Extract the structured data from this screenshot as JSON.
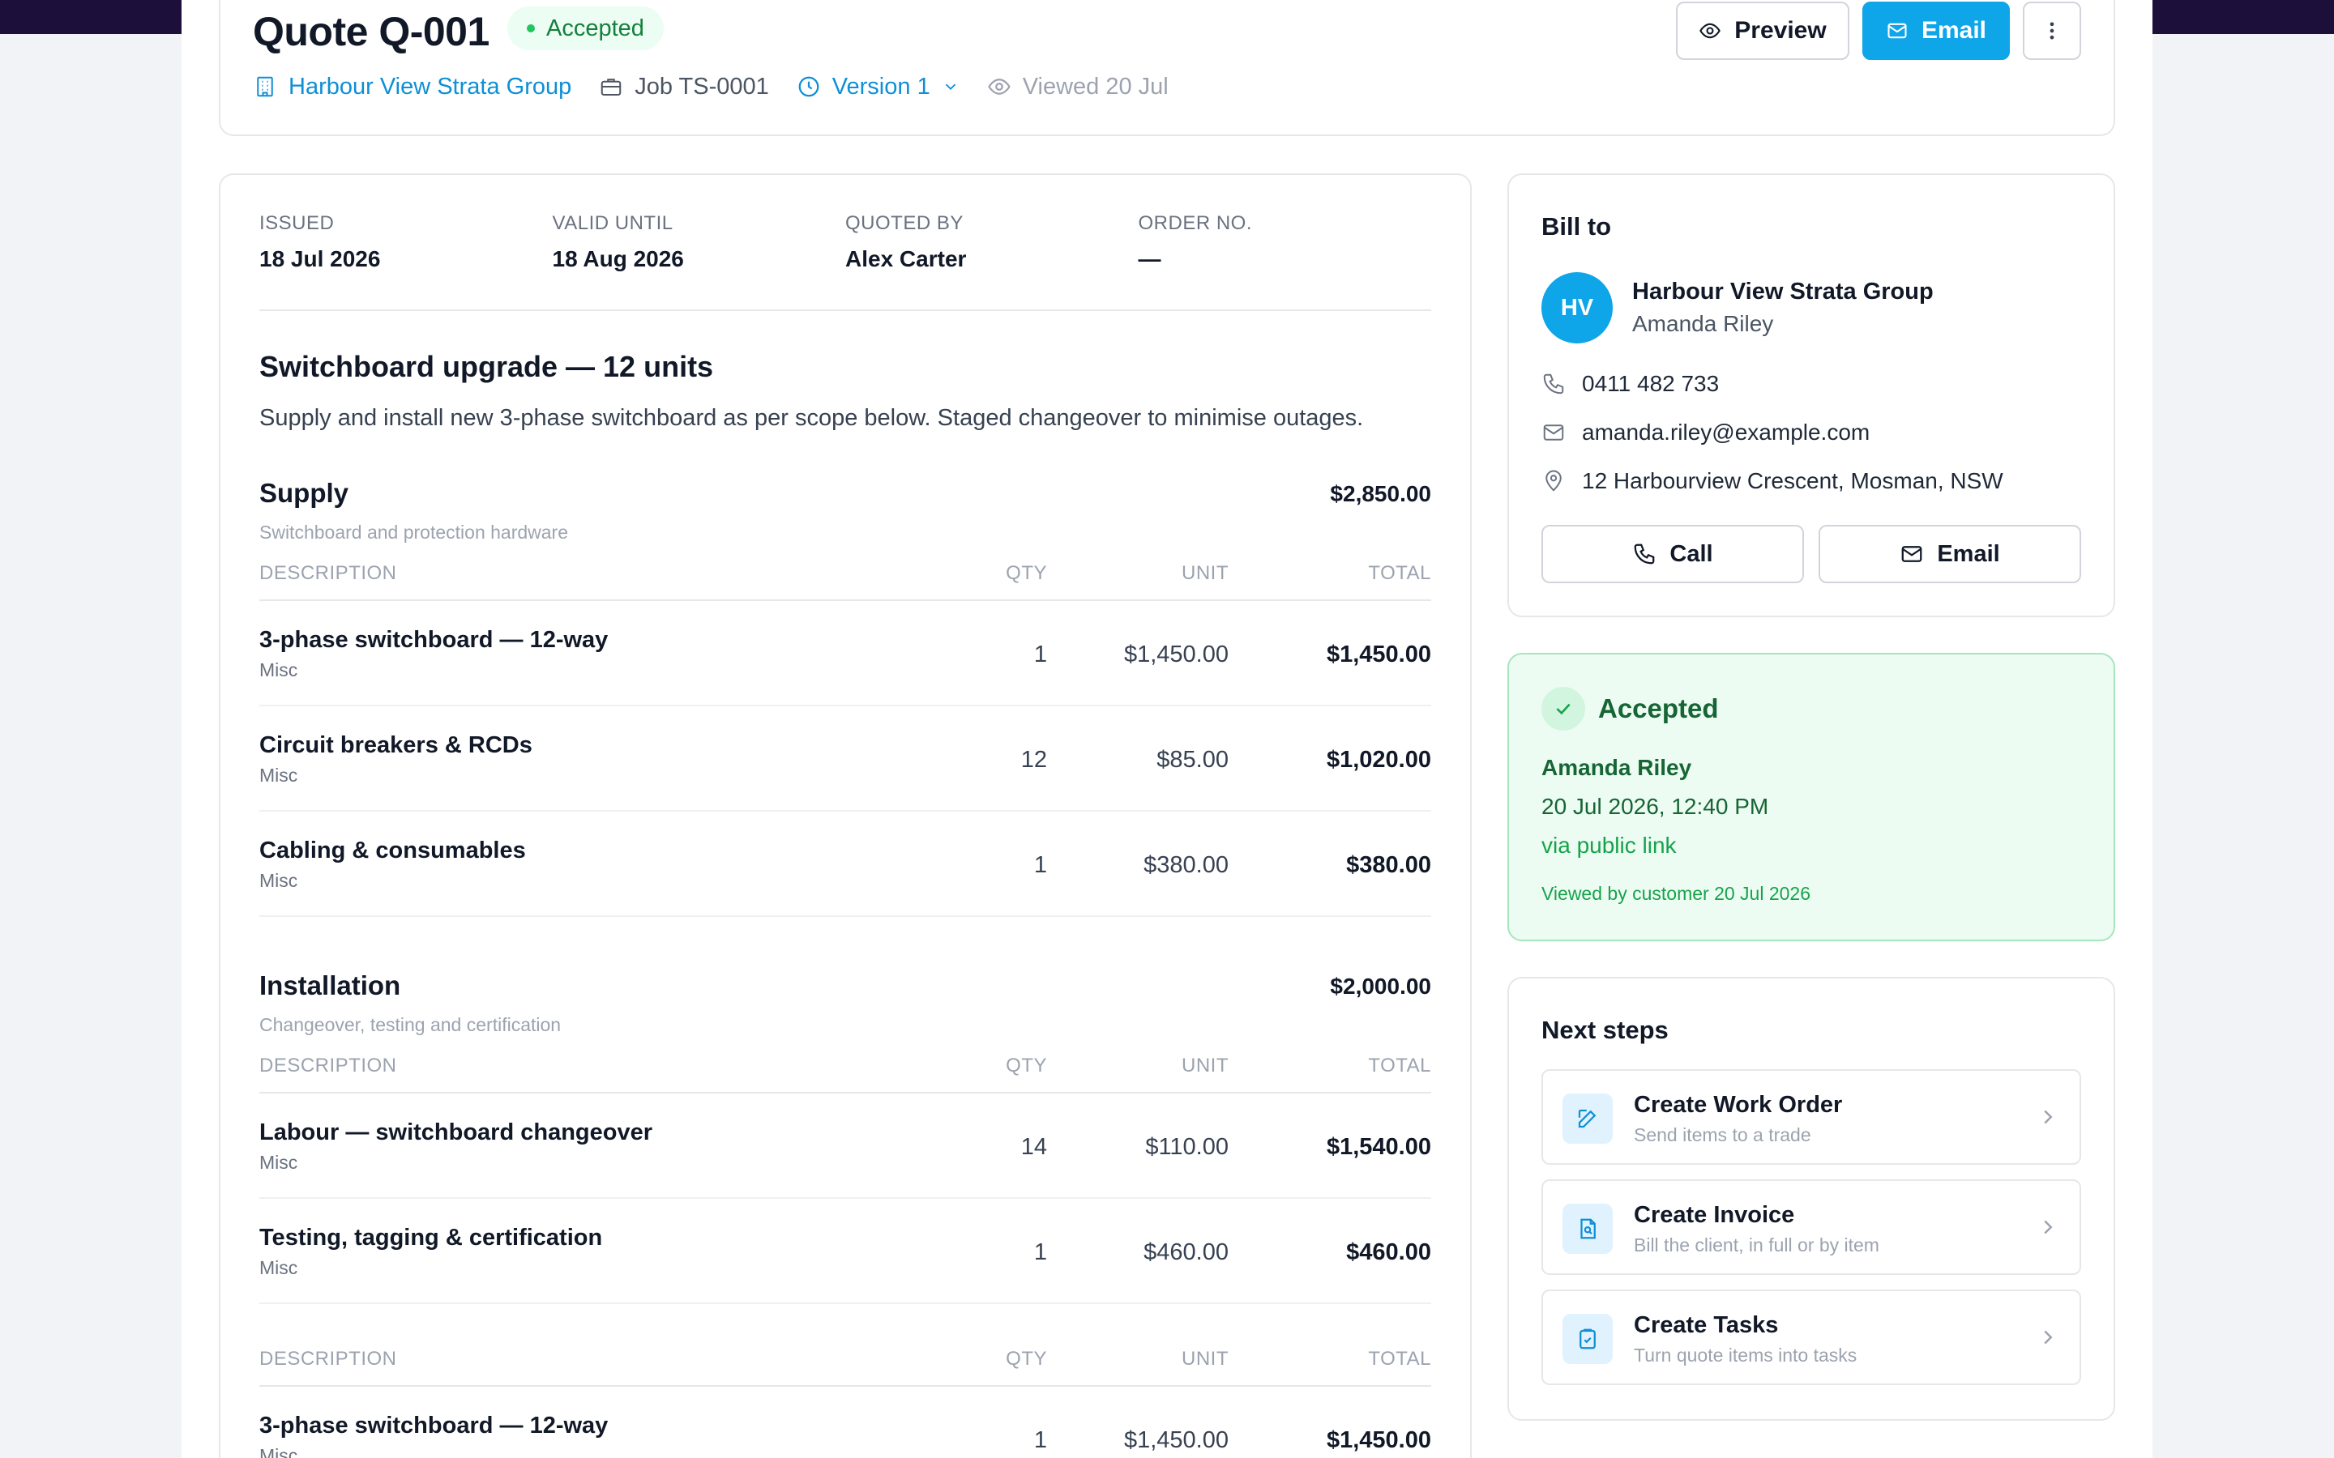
{
  "header": {
    "quote_title": "Quote Q-001",
    "status": "Accepted",
    "client_link": "Harbour View Strata Group",
    "job": "Job TS-0001",
    "version": "Version 1",
    "viewed": "Viewed 20 Jul",
    "preview_label": "Preview",
    "email_label": "Email",
    "colors": {
      "accent": "#0ea5e9",
      "success": "#15803d"
    }
  },
  "info": [
    {
      "label": "ISSUED",
      "value": "18 Jul 2026"
    },
    {
      "label": "VALID UNTIL",
      "value": "18 Aug 2026"
    },
    {
      "label": "QUOTED BY",
      "value": "Alex Carter"
    },
    {
      "label": "ORDER NO.",
      "value": "—"
    }
  ],
  "scope": {
    "title": "Switchboard upgrade — 12 units",
    "description": "Supply and install new 3-phase switchboard as per scope below. Staged changeover to minimise outages."
  },
  "table_headers": {
    "description": "DESCRIPTION",
    "qty": "QTY",
    "unit": "UNIT",
    "total": "TOTAL"
  },
  "sections": [
    {
      "name": "Supply",
      "total": "$2,850.00",
      "subtitle": "Switchboard and protection hardware",
      "items": [
        {
          "name": "3-phase switchboard — 12-way",
          "category": "Misc",
          "qty": "1",
          "unit": "$1,450.00",
          "total": "$1,450.00"
        },
        {
          "name": "Circuit breakers & RCDs",
          "category": "Misc",
          "qty": "12",
          "unit": "$85.00",
          "total": "$1,020.00"
        },
        {
          "name": "Cabling & consumables",
          "category": "Misc",
          "qty": "1",
          "unit": "$380.00",
          "total": "$380.00"
        }
      ]
    },
    {
      "name": "Installation",
      "total": "$2,000.00",
      "subtitle": "Changeover, testing and certification",
      "items": [
        {
          "name": "Labour — switchboard changeover",
          "category": "Misc",
          "qty": "14",
          "unit": "$110.00",
          "total": "$1,540.00"
        },
        {
          "name": "Testing, tagging & certification",
          "category": "Misc",
          "qty": "1",
          "unit": "$460.00",
          "total": "$460.00"
        }
      ]
    },
    {
      "items": [
        {
          "name": "3-phase switchboard — 12-way",
          "category": "Misc",
          "qty": "1",
          "unit": "$1,450.00",
          "total": "$1,450.00"
        }
      ]
    }
  ],
  "bill_to": {
    "heading": "Bill to",
    "initials": "HV",
    "company": "Harbour View Strata Group",
    "contact": "Amanda Riley",
    "phone": "0411 482 733",
    "email": "amanda.riley@example.com",
    "address": "12 Harbourview Crescent, Mosman, NSW",
    "call_label": "Call",
    "email_label": "Email"
  },
  "accepted": {
    "title": "Accepted",
    "name": "Amanda Riley",
    "datetime": "20 Jul 2026, 12:40 PM",
    "via": "via public link",
    "viewed": "Viewed by customer 20 Jul 2026"
  },
  "next_steps": {
    "heading": "Next steps",
    "items": [
      {
        "title": "Create Work Order",
        "subtitle": "Send items to a trade",
        "icon": "edit-icon"
      },
      {
        "title": "Create Invoice",
        "subtitle": "Bill the client, in full or by item",
        "icon": "invoice-icon"
      },
      {
        "title": "Create Tasks",
        "subtitle": "Turn quote items into tasks",
        "icon": "clipboard-icon"
      }
    ]
  }
}
